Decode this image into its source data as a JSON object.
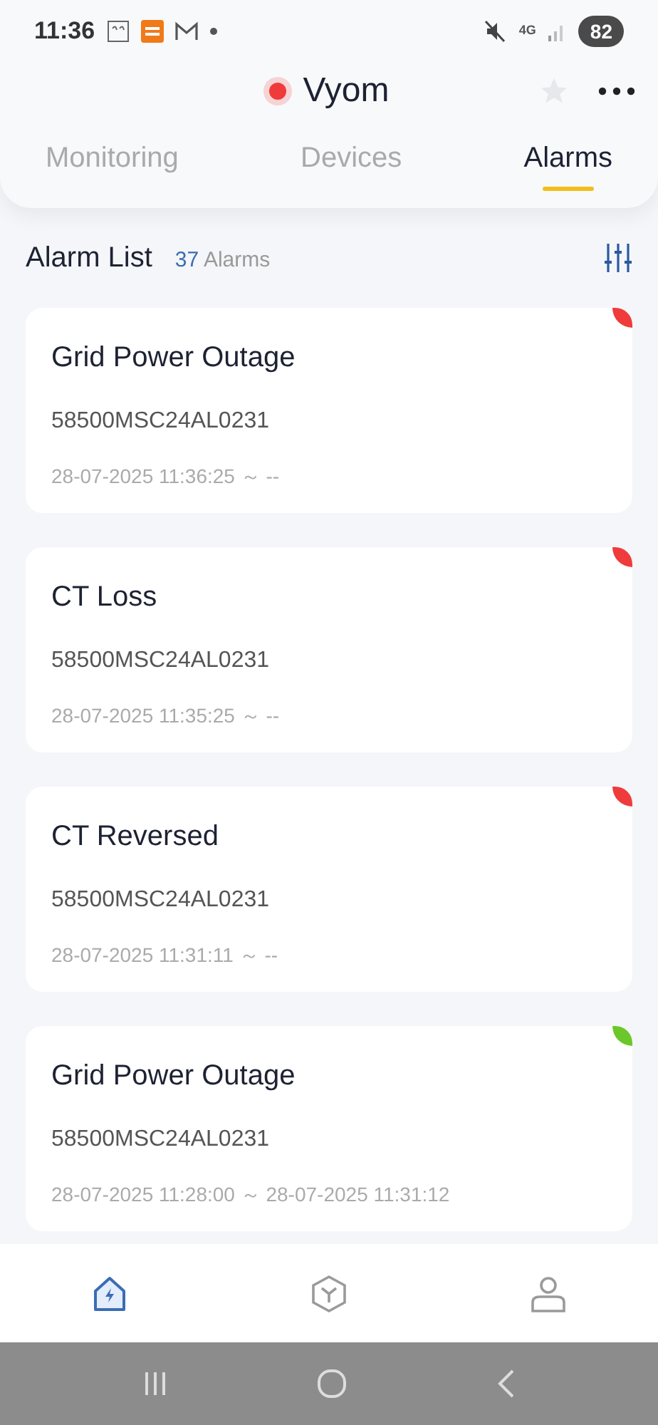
{
  "status_bar": {
    "time": "11:36",
    "network": "4G",
    "battery": "82"
  },
  "header": {
    "title": "Vyom",
    "fault": true,
    "favorite": false
  },
  "tabs": [
    {
      "label": "Monitoring",
      "selected": false
    },
    {
      "label": "Devices",
      "selected": false
    },
    {
      "label": "Alarms",
      "selected": true
    }
  ],
  "alarm_list": {
    "title": "Alarm List",
    "count": "37",
    "count_label": "Alarms"
  },
  "alarms": [
    {
      "title": "Grid Power Outage",
      "serial": "58500MSC24AL0231",
      "time": "28-07-2025 11:36:25 ～ --",
      "color": "#ef3b3b"
    },
    {
      "title": "CT Loss",
      "serial": "58500MSC24AL0231",
      "time": "28-07-2025 11:35:25 ～ --",
      "color": "#ef3b3b"
    },
    {
      "title": "CT Reversed",
      "serial": "58500MSC24AL0231",
      "time": "28-07-2025 11:31:11 ～ --",
      "color": "#ef3b3b"
    },
    {
      "title": "Grid Power Outage",
      "serial": "58500MSC24AL0231",
      "time": "28-07-2025 11:28:00 ～ 28-07-2025 11:31:12",
      "color": "#6cc72a"
    }
  ],
  "bottom_nav": [
    {
      "kind": "home",
      "selected": true
    },
    {
      "kind": "device",
      "selected": false
    },
    {
      "kind": "profile",
      "selected": false
    }
  ]
}
